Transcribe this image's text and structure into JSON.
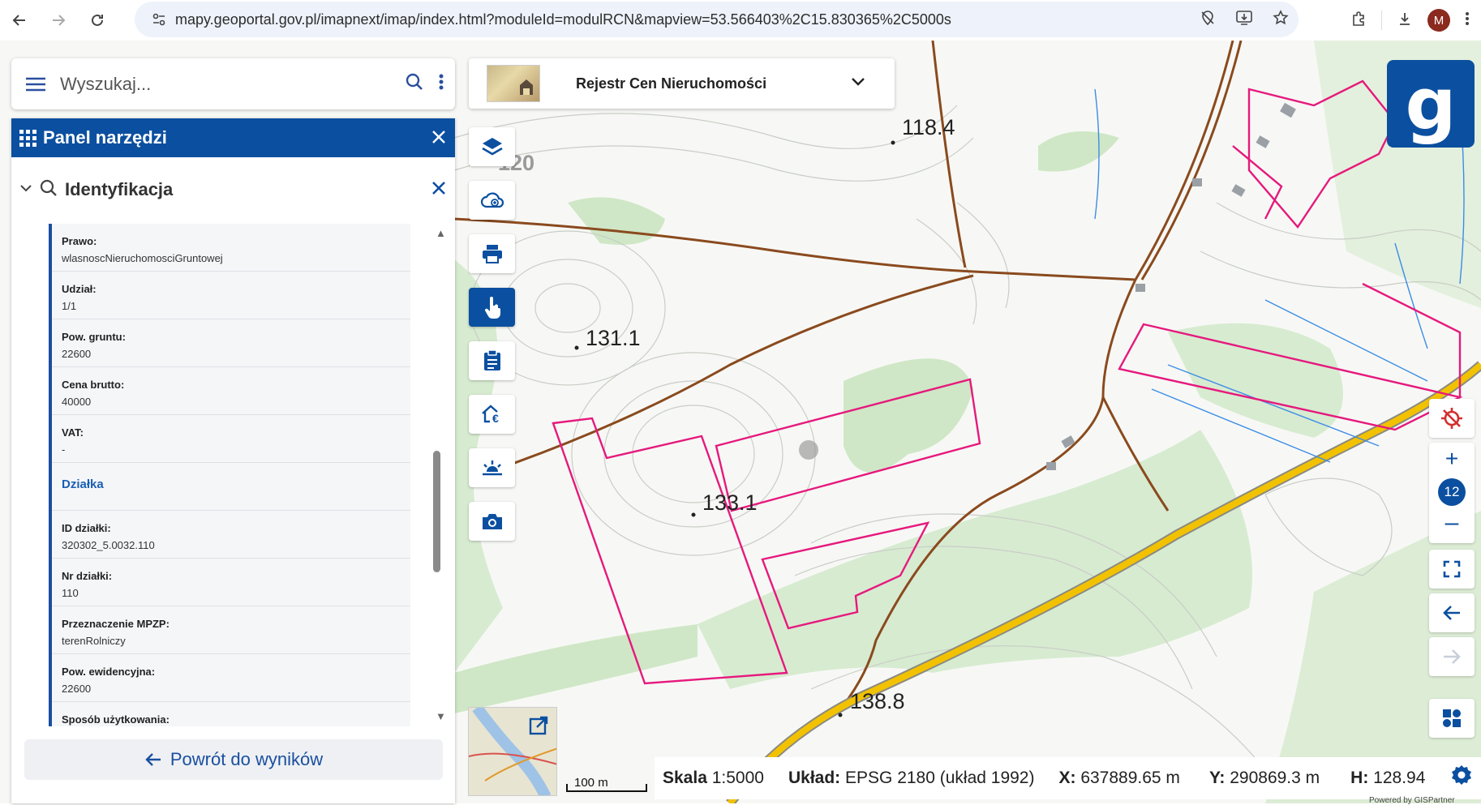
{
  "browser": {
    "url": "mapy.geoportal.gov.pl/imapnext/imap/index.html?moduleId=modulRCN&mapview=53.566403%2C15.830365%2C5000s",
    "avatar_letter": "M"
  },
  "search": {
    "placeholder": "Wyszukaj..."
  },
  "tools_panel": {
    "title": "Panel narzędzi"
  },
  "identification": {
    "title": "Identyfikacja",
    "rows": [
      {
        "key": "Prawo:",
        "value": "wlasnoscNieruchomosciGruntowej"
      },
      {
        "key": "Udział:",
        "value": "1/1"
      },
      {
        "key": "Pow. gruntu:",
        "value": "22600"
      },
      {
        "key": "Cena brutto:",
        "value": "40000"
      },
      {
        "key": "VAT:",
        "value": "-"
      }
    ],
    "section": "Działka",
    "rows2": [
      {
        "key": "ID działki:",
        "value": "320302_5.0032.110"
      },
      {
        "key": "Nr działki:",
        "value": "110"
      },
      {
        "key": "Przeznaczenie MPZP:",
        "value": "terenRolniczy"
      },
      {
        "key": "Pow. ewidencyjna:",
        "value": "22600"
      },
      {
        "key": "Sposób użytkowania:",
        "value": ""
      }
    ],
    "back_label": "Powrót do wyników"
  },
  "module": {
    "title": "Rejestr Cen Nieruchomości"
  },
  "map_labels": [
    "118.4",
    "131.1",
    "133.1",
    "138.8",
    "120"
  ],
  "zoom": {
    "level": "12"
  },
  "scale": {
    "bar_label": "100 m"
  },
  "status": {
    "scale_label": "Skala",
    "scale_value": "1:5000",
    "crs_label": "Układ:",
    "crs_value": "EPSG 2180 (układ 1992)",
    "x_label": "X:",
    "x_value": "637889.65 m",
    "y_label": "Y:",
    "y_value": "290869.3 m",
    "h_label": "H:",
    "h_value": "128.94",
    "powered": "Powered by GISPartner"
  },
  "colors": {
    "accent": "#0b4fa0",
    "parcel_border": "#e6197d",
    "road": "#f2c200",
    "forest": "#cfe7c6"
  }
}
